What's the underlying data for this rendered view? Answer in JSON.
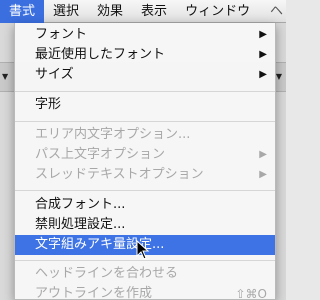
{
  "menubar": {
    "items": [
      {
        "label": "書式"
      },
      {
        "label": "選択"
      },
      {
        "label": "効果"
      },
      {
        "label": "表示"
      },
      {
        "label": "ウィンドウ"
      }
    ],
    "edge_char": "ヘ",
    "accent": "#3b6fe0"
  },
  "background": {
    "left_arrow": "▼",
    "right_arrow": "▼"
  },
  "menu": {
    "groups": [
      [
        {
          "label": "フォント",
          "submenu": true,
          "enabled": true
        },
        {
          "label": "最近使用したフォント",
          "submenu": true,
          "enabled": true
        },
        {
          "label": "サイズ",
          "submenu": true,
          "enabled": true
        }
      ],
      [
        {
          "label": "字形",
          "submenu": false,
          "enabled": true
        }
      ],
      [
        {
          "label": "エリア内文字オプション...",
          "submenu": false,
          "enabled": false
        },
        {
          "label": "パス上文字オプション",
          "submenu": true,
          "enabled": false
        },
        {
          "label": "スレッドテキストオプション",
          "submenu": true,
          "enabled": false
        }
      ],
      [
        {
          "label": "合成フォント...",
          "submenu": false,
          "enabled": true
        },
        {
          "label": "禁則処理設定...",
          "submenu": false,
          "enabled": true
        },
        {
          "label": "文字組みアキ量設定...",
          "submenu": false,
          "enabled": true,
          "highlighted": true
        }
      ],
      [
        {
          "label": "ヘッドラインを合わせる",
          "submenu": false,
          "enabled": false
        },
        {
          "label": "アウトラインを作成",
          "submenu": false,
          "enabled": false,
          "shortcut": "⇧⌘O"
        }
      ]
    ],
    "submenu_arrow": "▶",
    "highlight_color": "#3e73e6",
    "disabled_color": "#a8a8a8"
  },
  "cursor": {
    "icon": "arrow-pointer"
  }
}
